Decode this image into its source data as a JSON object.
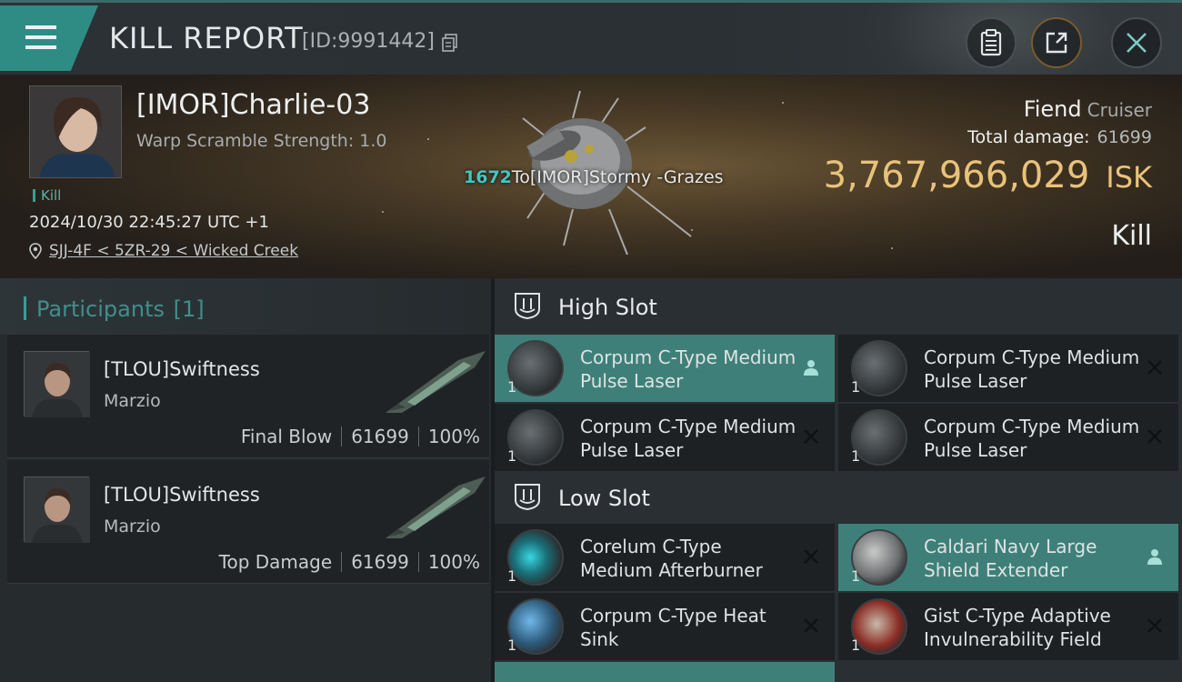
{
  "header": {
    "title": "KILL REPORT",
    "report_id": "[ID:9991442]"
  },
  "victim": {
    "name": "[IMOR]Charlie-03",
    "warp_scramble": "Warp Scramble Strength: 1.0",
    "kill_tag": "Kill",
    "timestamp": "2024/10/30 22:45:27 UTC +1",
    "location": "SJJ-4F < 5ZR-29 < Wicked Creek",
    "ship_name": "Fiend",
    "ship_class": "Cruiser",
    "total_damage_label": "Total damage:",
    "total_damage": "61699",
    "isk_value": "3,767,966,029",
    "isk_unit": "ISK",
    "result": "Kill",
    "damage_event": {
      "amount": "1672",
      "text": "To[IMOR]Stormy -Grazes"
    }
  },
  "participants": {
    "title": "Participants",
    "count": "[1]",
    "rows": [
      {
        "name": "[TLOU]Swiftness",
        "corp": "Marzio",
        "role": "Final Blow",
        "damage": "61699",
        "percent": "100%"
      },
      {
        "name": "[TLOU]Swiftness",
        "corp": "Marzio",
        "role": "Top Damage",
        "damage": "61699",
        "percent": "100%"
      }
    ]
  },
  "slots": {
    "high": {
      "title": "High Slot",
      "modules": [
        {
          "name": "Corpum C-Type Medium Pulse Laser",
          "qty": "1",
          "state": "person-icon",
          "selected": true
        },
        {
          "name": "Corpum C-Type Medium Pulse Laser",
          "qty": "1",
          "state": "close-icon",
          "selected": false
        },
        {
          "name": "Corpum C-Type Medium Pulse Laser",
          "qty": "1",
          "state": "close-icon",
          "selected": false
        },
        {
          "name": "Corpum C-Type Medium Pulse Laser",
          "qty": "1",
          "state": "close-icon",
          "selected": false
        }
      ]
    },
    "low": {
      "title": "Low Slot",
      "modules": [
        {
          "name": "Corelum C-Type Medium Afterburner",
          "qty": "1",
          "state": "close-icon",
          "selected": false
        },
        {
          "name": "Caldari Navy Large Shield Extender",
          "qty": "1",
          "state": "person-icon",
          "selected": true
        },
        {
          "name": "Corpum C-Type Heat Sink",
          "qty": "1",
          "state": "close-icon",
          "selected": false
        },
        {
          "name": "Gist C-Type Adaptive Invulnerability Field",
          "qty": "1",
          "state": "close-icon",
          "selected": false
        }
      ]
    }
  },
  "colors": {
    "accent": "#3c9b93",
    "selected_row": "#3e8079",
    "isk_gold": "#e9c27a",
    "damage_cyan": "#3fc7c6"
  }
}
